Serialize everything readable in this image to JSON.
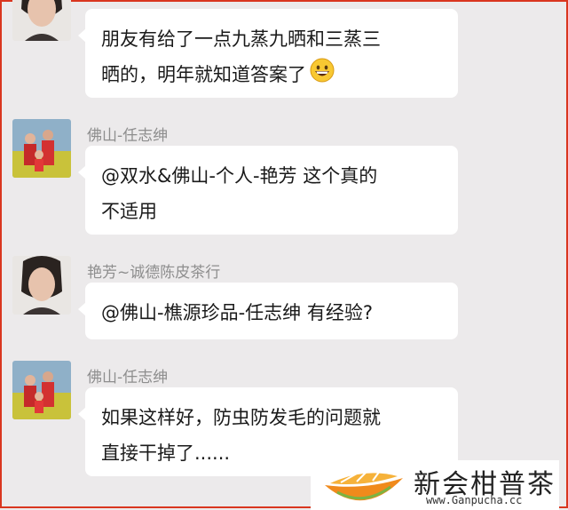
{
  "messages": [
    {
      "sender": "",
      "lines": [
        "朋友有给了一点九蒸九晒和三蒸三",
        "晒的，明年就知道答案了"
      ],
      "emoji": "grinning-face-icon"
    },
    {
      "sender": "佛山-任志绅",
      "lines": [
        "@双水&佛山-个人-艳芳  这个真的",
        "不适用"
      ]
    },
    {
      "sender": "艳芳~诚德陈皮茶行",
      "lines": [
        "@佛山-樵源珍品-任志绅  有经验?"
      ]
    },
    {
      "sender": "佛山-任志绅",
      "lines": [
        "如果这样好，防虫防发毛的问题就",
        "直接干掉了......"
      ]
    }
  ],
  "watermark": {
    "name": "新会柑普茶",
    "url": "www.Ganpucha.cc"
  },
  "colors": {
    "background": "#eceaeb",
    "bubble": "#ffffff",
    "sender_text": "#8e8e8e",
    "frame": "#d9361f",
    "logo_orange": "#f08a1c"
  }
}
